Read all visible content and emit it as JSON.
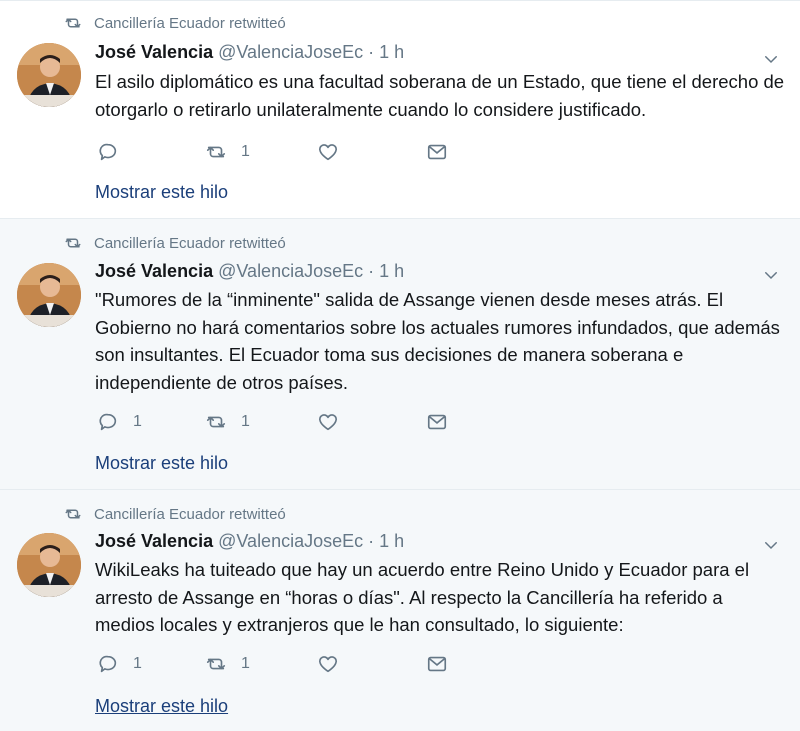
{
  "tweets": [
    {
      "retweeted_by": "Cancillería Ecuador retwitteó",
      "name": "José Valencia",
      "handle": "@ValenciaJoseEc",
      "time": "· 1 h",
      "text": "El asilo diplomático es una facultad soberana de un Estado, que tiene el derecho de otorgarlo o retirarlo unilateralmente cuando lo considere justificado.",
      "reply_count": "",
      "retweet_count": "1",
      "like_count": "",
      "thread_label": "Mostrar este hilo"
    },
    {
      "retweeted_by": "Cancillería Ecuador retwitteó",
      "name": "José Valencia",
      "handle": "@ValenciaJoseEc",
      "time": "· 1 h",
      "text": "\"Rumores de la “inminente\" salida de Assange vienen desde meses atrás. El Gobierno no hará comentarios sobre los actuales rumores infundados, que además son insultantes. El Ecuador toma sus decisiones de manera soberana e independiente de otros países.",
      "reply_count": "1",
      "retweet_count": "1",
      "like_count": "",
      "thread_label": "Mostrar este hilo"
    },
    {
      "retweeted_by": "Cancillería Ecuador retwitteó",
      "name": "José Valencia",
      "handle": "@ValenciaJoseEc",
      "time": "· 1 h",
      "text": "WikiLeaks ha tuiteado que hay un acuerdo entre Reino Unido y Ecuador para el arresto de Assange en “horas o días\". Al respecto la Cancillería ha referido a medios locales y extranjeros que le han consultado, lo siguiente:",
      "reply_count": "1",
      "retweet_count": "1",
      "like_count": "",
      "thread_label": "Mostrar este hilo"
    }
  ],
  "colors": {
    "highlight_bg": "#f5f8fa",
    "muted": "#657786",
    "link": "#1b3f7a",
    "border": "#e6ecf0"
  }
}
